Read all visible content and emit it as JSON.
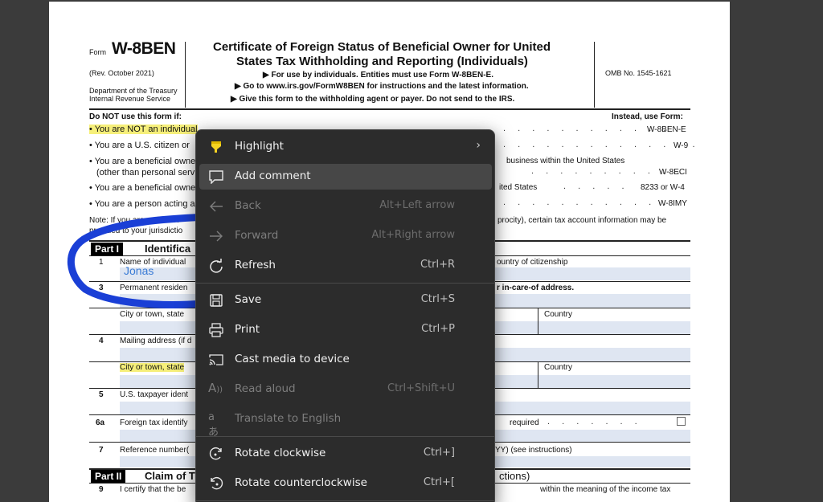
{
  "form": {
    "form_word": "Form",
    "form_id": "W-8BEN",
    "rev": "(Rev. October 2021)",
    "dept1": "Department of the Treasury",
    "dept2": "Internal Revenue Service",
    "title1": "Certificate of Foreign Status of Beneficial Owner for United",
    "title2": "States Tax Withholding and Reporting (Individuals)",
    "instr1": "▶ For use by individuals. Entities must use Form W-8BEN-E.",
    "instr2": "▶ Go to www.irs.gov/FormW8BEN for instructions and the latest information.",
    "instr3": "▶ Give this form to the withholding agent or payer. Do not send to the IRS.",
    "omb": "OMB No. 1545-1621",
    "donot": "Do NOT use this form if:",
    "instead": "Instead, use Form:",
    "rows": [
      {
        "left": "• You are NOT an individual",
        "right": "W-8BEN-E"
      },
      {
        "left": "• You are a U.S. citizen or",
        "right": "W-9"
      },
      {
        "left": "• You are a beneficial owne",
        "mid": "business within the United States"
      },
      {
        "left": "(other than personal serv",
        "right": "W-8ECI"
      },
      {
        "left": "• You are a beneficial owne",
        "mid": "ited States",
        "right": "8233 or W-4"
      },
      {
        "left": "• You are a person acting a",
        "right": "W-8IMY"
      }
    ],
    "note_left": "Note: If you are resident i",
    "note_right": "procity), certain tax account information may be",
    "note_left2": "provided to your jurisdictio",
    "part1_label": "Part I",
    "part1_title": "Identifica",
    "line1_num": "1",
    "line1_label": "Name of individual",
    "line1_right": "ountry of citizenship",
    "line1_value": "Jonas",
    "line3_num": "3",
    "line3_label": "Permanent residen",
    "line3_right": "r in-care-of address.",
    "city1": "City or town, state",
    "country1": "Country",
    "line4_num": "4",
    "line4_label": "Mailing address (if d",
    "city2": "City or town, state",
    "country2": "Country",
    "line5_num": "5",
    "line5_label": "U.S. taxpayer ident",
    "line6_num": "6a",
    "line6_label": "Foreign tax identify",
    "line6_right": "required",
    "line7_num": "7",
    "line7_label": "Reference number(",
    "line7_right": "YY) (see instructions)",
    "part2_label": "Part II",
    "part2_title": "Claim of T",
    "part2_right": "ctions)",
    "line9_num": "9",
    "line9_label": "I certify that the be",
    "line9_right": "within the meaning of the income tax"
  },
  "menu": {
    "items": [
      {
        "label": "Highlight",
        "shortcut": "",
        "icon": "highlighter-icon",
        "disabled": false
      },
      {
        "label": "Add comment",
        "shortcut": "",
        "icon": "comment-icon",
        "disabled": false
      },
      {
        "label": "Back",
        "shortcut": "Alt+Left arrow",
        "icon": "back-arrow-icon",
        "disabled": true
      },
      {
        "label": "Forward",
        "shortcut": "Alt+Right arrow",
        "icon": "forward-arrow-icon",
        "disabled": true
      },
      {
        "label": "Refresh",
        "shortcut": "Ctrl+R",
        "icon": "refresh-icon",
        "disabled": false
      },
      {
        "label": "Save",
        "shortcut": "Ctrl+S",
        "icon": "save-icon",
        "disabled": false
      },
      {
        "label": "Print",
        "shortcut": "Ctrl+P",
        "icon": "print-icon",
        "disabled": false
      },
      {
        "label": "Cast media to device",
        "shortcut": "",
        "icon": "cast-icon",
        "disabled": false
      },
      {
        "label": "Read aloud",
        "shortcut": "Ctrl+Shift+U",
        "icon": "read-aloud-icon",
        "disabled": true
      },
      {
        "label": "Translate to English",
        "shortcut": "",
        "icon": "translate-icon",
        "disabled": true
      },
      {
        "label": "Rotate clockwise",
        "shortcut": "Ctrl+]",
        "icon": "rotate-clockwise-icon",
        "disabled": false
      },
      {
        "label": "Rotate counterclockwise",
        "shortcut": "Ctrl+[",
        "icon": "rotate-counterclockwise-icon",
        "disabled": false
      }
    ]
  },
  "colors": {
    "highlight": "#f6ef7a",
    "ink_annotation": "#1a3fd6",
    "field_shade": "#dfe6f2",
    "menu_bg": "#2c2c2c",
    "menu_hover": "#474747"
  }
}
